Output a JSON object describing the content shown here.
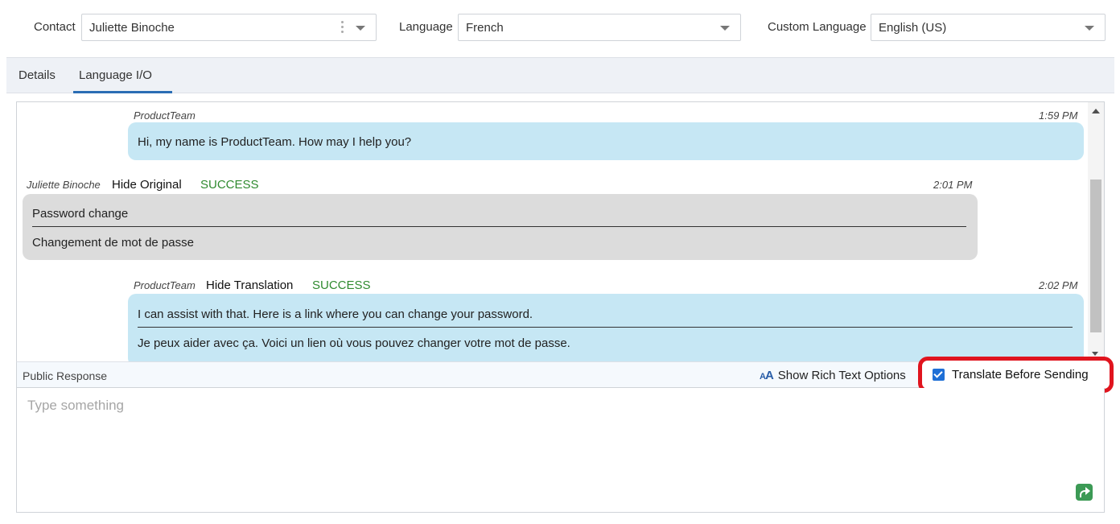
{
  "header": {
    "contact_label": "Contact",
    "contact_value": "Juliette Binoche",
    "language_label": "Language",
    "language_value": "French",
    "custom_language_label": "Custom Language",
    "custom_language_value": "English (US)"
  },
  "tabs": [
    {
      "label": "Details",
      "active": false
    },
    {
      "label": "Language I/O",
      "active": true
    }
  ],
  "messages": [
    {
      "sender": "ProductTeam",
      "time": "1:59 PM",
      "toggle": "",
      "status": "",
      "lines": [
        "Hi, my name is ProductTeam. How may I help you?"
      ]
    },
    {
      "sender": "Juliette Binoche",
      "time": "2:01 PM",
      "toggle": "Hide Original",
      "status": "SUCCESS",
      "lines": [
        "Password change",
        "Changement de mot de passe"
      ]
    },
    {
      "sender": "ProductTeam",
      "time": "2:02 PM",
      "toggle": "Hide Translation",
      "status": "SUCCESS",
      "lines": [
        "I can assist with that. Here is a link where you can change your password.",
        "Je peux aider avec ça. Voici un lien où vous pouvez changer votre mot de passe."
      ]
    }
  ],
  "response": {
    "label": "Public Response",
    "rich_text_label": "Show Rich Text Options",
    "translate_label": "Translate Before Sending",
    "translate_checked": true,
    "placeholder": "Type something"
  },
  "colors": {
    "agent_bubble": "#c6e7f4",
    "customer_bubble": "#dcdcdc",
    "success": "#2f8a2f",
    "highlight": "#e0141e",
    "tab_accent": "#2a6db4"
  },
  "icons": [
    "chevron-down-icon",
    "more-vert-icon",
    "font-size-icon",
    "send-icon",
    "checkbox-icon"
  ]
}
